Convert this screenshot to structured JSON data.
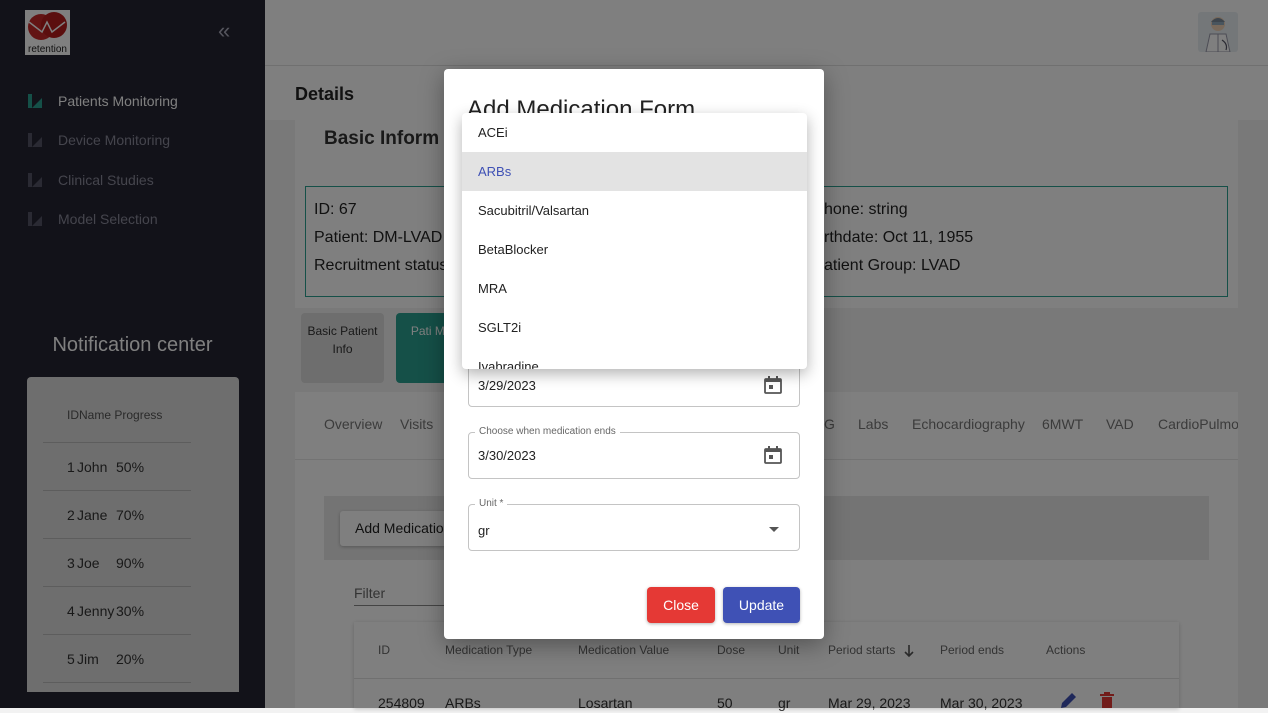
{
  "sidebar": {
    "logo_text": "retention",
    "nav": [
      {
        "label": "Patients Monitoring",
        "active": true
      },
      {
        "label": "Device Monitoring",
        "active": false
      },
      {
        "label": "Clinical Studies",
        "active": false
      },
      {
        "label": "Model Selection",
        "active": false
      }
    ],
    "notification_title": "Notification center",
    "notification_header": "IDName Progress",
    "notifications": [
      {
        "id": "1",
        "name": "John",
        "progress": "50%"
      },
      {
        "id": "2",
        "name": "Jane",
        "progress": "70%"
      },
      {
        "id": "3",
        "name": "Joe",
        "progress": "90%"
      },
      {
        "id": "4",
        "name": "Jenny",
        "progress": "30%"
      },
      {
        "id": "5",
        "name": "Jim",
        "progress": "20%"
      }
    ]
  },
  "main": {
    "details_title": "Details",
    "basic_info_title": "Basic Inform",
    "info": {
      "id": "ID: 67",
      "patient": "Patient: DM-LVAD",
      "recruitment": "Recruitment status",
      "phone": "hone: string",
      "birthdate": "rthdate: Oct 11, 1955",
      "group": "atient Group: LVAD"
    },
    "tiles": [
      {
        "label": "Basic Patient Info"
      },
      {
        "label": "Pati Monit"
      }
    ],
    "tabs": [
      "Overview",
      "Visits",
      "G",
      "Labs",
      "Echocardiography",
      "6MWT",
      "VAD",
      "CardioPulmon"
    ],
    "add_med_label": "Add Medicatio",
    "filter_placeholder": "Filter",
    "table": {
      "headers": [
        "ID",
        "Medication Type",
        "Medication Value",
        "Dose",
        "Unit",
        "Period starts",
        "Period ends",
        "Actions"
      ],
      "rows": [
        {
          "id": "254809",
          "type": "ARBs",
          "value": "Losartan",
          "dose": "50",
          "unit": "gr",
          "start": "Mar 29, 2023",
          "end": "Mar 30, 2023"
        }
      ]
    }
  },
  "modal": {
    "title": "Add Medication Form",
    "start_date": {
      "value": "3/29/2023"
    },
    "end_date": {
      "label": "Choose when medication ends",
      "value": "3/30/2023"
    },
    "unit": {
      "label": "Unit *",
      "value": "gr"
    },
    "close_label": "Close",
    "update_label": "Update",
    "dropdown_options": [
      "ACEi",
      "ARBs",
      "Sacubitril/Valsartan",
      "BetaBlocker",
      "MRA",
      "SGLT2i",
      "Ivabradine"
    ],
    "dropdown_selected": "ARBs"
  },
  "colors": {
    "sidebar_bg": "#242433",
    "accent_teal": "#2aa191",
    "close_red": "#e53935",
    "update_indigo": "#3f51b5",
    "delete_red": "#e53935"
  }
}
